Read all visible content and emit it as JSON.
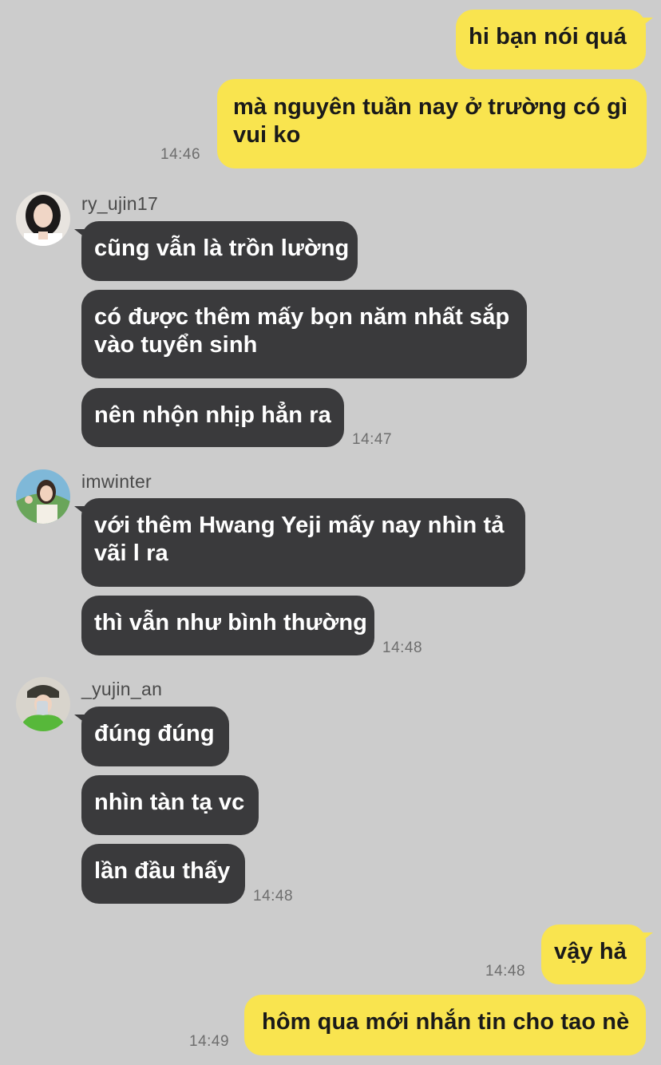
{
  "colors": {
    "background": "#cccccc",
    "mine_bubble": "#f9e44f",
    "theirs_bubble": "#3a3a3c"
  },
  "messages": {
    "m1": "hi bạn nói quá",
    "m2": "mà nguyên tuần nay ở trường có gì vui ko",
    "m2_time": "14:46",
    "g1": {
      "sender": "ry_ujin17",
      "avatar_icon": "user-avatar-icon",
      "msg1": "cũng vẫn là trồn lường",
      "msg2": "có được thêm mấy bọn năm nhất sắp vào tuyển sinh",
      "msg3": "nên nhộn nhịp hẳn ra",
      "time": "14:47"
    },
    "g2": {
      "sender": "imwinter",
      "avatar_icon": "user-avatar-icon",
      "msg1": "với thêm Hwang Yeji mấy nay nhìn tả vãi l ra",
      "msg2": "thì vẫn như bình thường",
      "time": "14:48"
    },
    "g3": {
      "sender": "_yujin_an",
      "avatar_icon": "user-avatar-icon",
      "msg1": "đúng đúng",
      "msg2": "nhìn tàn tạ vc",
      "msg3": "lần đầu thấy",
      "time": "14:48"
    },
    "m3": "vậy hả",
    "m3_time": "14:48",
    "m4": "hôm qua mới nhắn tin cho tao nè",
    "m4_time": "14:49"
  }
}
